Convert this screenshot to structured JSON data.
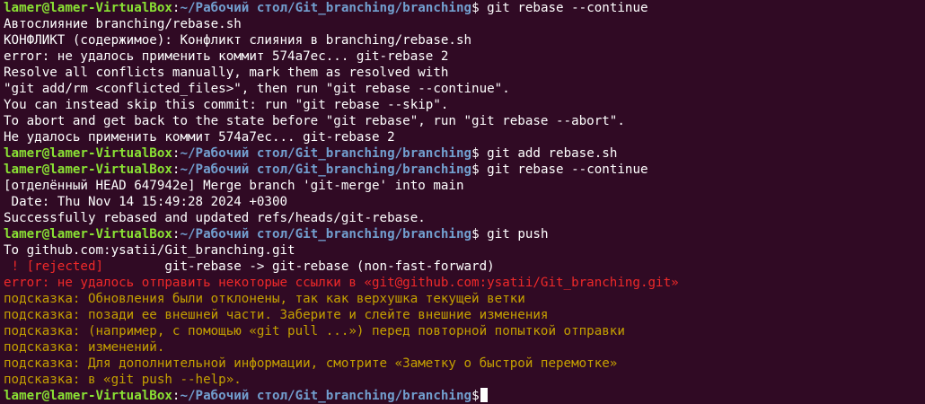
{
  "colors": {
    "background": "#300a24",
    "prompt_user": "#8ae234",
    "prompt_path": "#729fcf",
    "text": "#ffffff",
    "error": "#ef2929",
    "hint": "#c4a000"
  },
  "prompt": {
    "user_host": "lamer@lamer-VirtualBox",
    "path": "~/Рабочий стол/Git_branching/branching",
    "symbol": "$"
  },
  "lines": [
    {
      "type": "prompt",
      "cmd": " git rebase --continue"
    },
    {
      "type": "text",
      "text": "Автослияние branching/rebase.sh"
    },
    {
      "type": "text",
      "text": "КОНФЛИКТ (содержимое): Конфликт слияния в branching/rebase.sh"
    },
    {
      "type": "text",
      "text": "error: не удалось применить коммит 574a7ec... git-rebase 2"
    },
    {
      "type": "text",
      "text": "Resolve all conflicts manually, mark them as resolved with"
    },
    {
      "type": "text",
      "text": "\"git add/rm <conflicted_files>\", then run \"git rebase --continue\"."
    },
    {
      "type": "text",
      "text": "You can instead skip this commit: run \"git rebase --skip\"."
    },
    {
      "type": "text",
      "text": "To abort and get back to the state before \"git rebase\", run \"git rebase --abort\"."
    },
    {
      "type": "text",
      "text": "Не удалось применить коммит 574a7ec... git-rebase 2"
    },
    {
      "type": "prompt",
      "cmd": " git add rebase.sh"
    },
    {
      "type": "prompt",
      "cmd": " git rebase --continue"
    },
    {
      "type": "text",
      "text": "[отделённый HEAD 647942e] Merge branch 'git-merge' into main"
    },
    {
      "type": "text",
      "text": " Date: Thu Nov 14 15:49:28 2024 +0300"
    },
    {
      "type": "text",
      "text": "Successfully rebased and updated refs/heads/git-rebase."
    },
    {
      "type": "prompt",
      "cmd": " git push"
    },
    {
      "type": "text",
      "text": "To github.com:ysatii/Git_branching.git"
    },
    {
      "type": "rejected",
      "tag": " ! [rejected]",
      "text": "        git-rebase -> git-rebase (non-fast-forward)"
    },
    {
      "type": "error",
      "text": "error: не удалось отправить некоторые ссылки в «git@github.com:ysatii/Git_branching.git»"
    },
    {
      "type": "hint",
      "text": "подсказка: Обновления были отклонены, так как верхушка текущей ветки"
    },
    {
      "type": "hint",
      "text": "подсказка: позади ее внешней части. Заберите и слейте внешние изменения"
    },
    {
      "type": "hint",
      "text": "подсказка: (например, с помощью «git pull ...») перед повторной попыткой отправки"
    },
    {
      "type": "hint",
      "text": "подсказка: изменений."
    },
    {
      "type": "hint",
      "text": "подсказка: Для дополнительной информации, смотрите «Заметку о быстрой перемотке»"
    },
    {
      "type": "hint",
      "text": "подсказка: в «git push --help»."
    },
    {
      "type": "prompt",
      "cmd": "",
      "cursor": true
    }
  ]
}
